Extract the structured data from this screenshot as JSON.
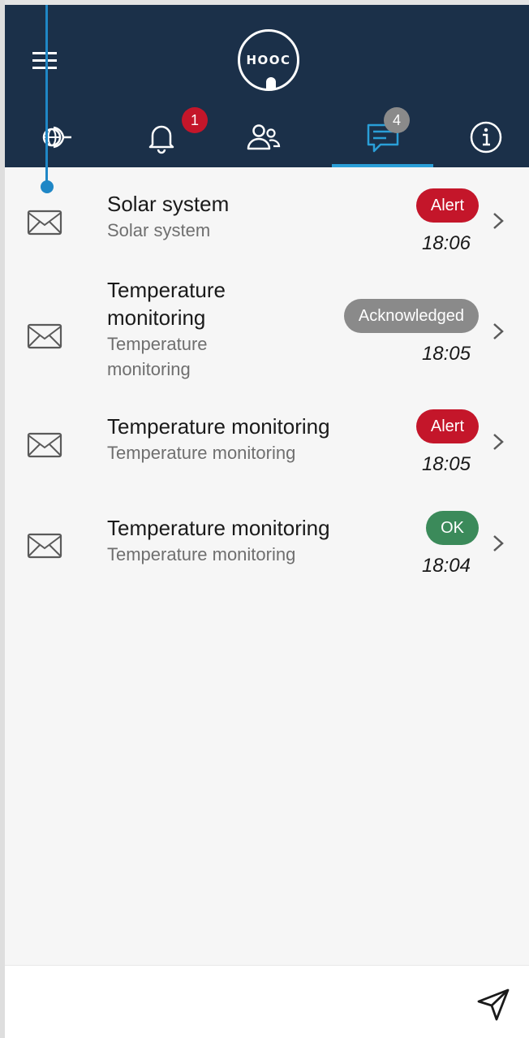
{
  "logo": {
    "text": "HOOC"
  },
  "tabs": [
    {
      "icon": "globe-remote-icon",
      "active": false
    },
    {
      "icon": "bell-icon",
      "badge": "1",
      "badge_color": "#c4162a",
      "active": false
    },
    {
      "icon": "users-icon",
      "active": false
    },
    {
      "icon": "chat-icon",
      "badge": "4",
      "badge_color": "#8a8a8a",
      "active": true
    },
    {
      "icon": "info-icon",
      "active": false
    }
  ],
  "colors": {
    "header": "#1b3049",
    "accent": "#2a9fd8",
    "alert": "#c4162a",
    "acknowledged": "#8a8a8a",
    "ok": "#3b8a5a"
  },
  "messages": [
    {
      "title": "Solar system",
      "subtitle": "Solar system",
      "status": "Alert",
      "time": "18:06"
    },
    {
      "title": "Temperature monitoring",
      "subtitle": "Temperature monitoring",
      "status": "Acknowledged",
      "time": "18:05"
    },
    {
      "title": "Temperature monitoring",
      "subtitle": "Temperature monitoring",
      "status": "Alert",
      "time": "18:05"
    },
    {
      "title": "Temperature monitoring",
      "subtitle": "Temperature monitoring",
      "status": "OK",
      "time": "18:04"
    }
  ],
  "footer": {
    "icon": "send-icon"
  }
}
